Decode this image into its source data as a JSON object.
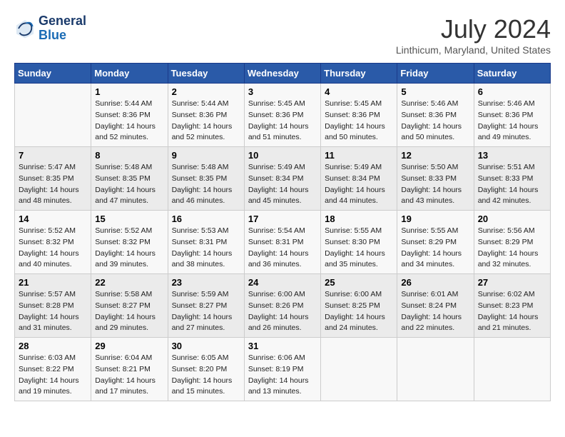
{
  "header": {
    "logo_line1": "General",
    "logo_line2": "Blue",
    "month_year": "July 2024",
    "location": "Linthicum, Maryland, United States"
  },
  "weekdays": [
    "Sunday",
    "Monday",
    "Tuesday",
    "Wednesday",
    "Thursday",
    "Friday",
    "Saturday"
  ],
  "weeks": [
    [
      {
        "day": "",
        "info": ""
      },
      {
        "day": "1",
        "info": "Sunrise: 5:44 AM\nSunset: 8:36 PM\nDaylight: 14 hours\nand 52 minutes."
      },
      {
        "day": "2",
        "info": "Sunrise: 5:44 AM\nSunset: 8:36 PM\nDaylight: 14 hours\nand 52 minutes."
      },
      {
        "day": "3",
        "info": "Sunrise: 5:45 AM\nSunset: 8:36 PM\nDaylight: 14 hours\nand 51 minutes."
      },
      {
        "day": "4",
        "info": "Sunrise: 5:45 AM\nSunset: 8:36 PM\nDaylight: 14 hours\nand 50 minutes."
      },
      {
        "day": "5",
        "info": "Sunrise: 5:46 AM\nSunset: 8:36 PM\nDaylight: 14 hours\nand 50 minutes."
      },
      {
        "day": "6",
        "info": "Sunrise: 5:46 AM\nSunset: 8:36 PM\nDaylight: 14 hours\nand 49 minutes."
      }
    ],
    [
      {
        "day": "7",
        "info": "Sunrise: 5:47 AM\nSunset: 8:35 PM\nDaylight: 14 hours\nand 48 minutes."
      },
      {
        "day": "8",
        "info": "Sunrise: 5:48 AM\nSunset: 8:35 PM\nDaylight: 14 hours\nand 47 minutes."
      },
      {
        "day": "9",
        "info": "Sunrise: 5:48 AM\nSunset: 8:35 PM\nDaylight: 14 hours\nand 46 minutes."
      },
      {
        "day": "10",
        "info": "Sunrise: 5:49 AM\nSunset: 8:34 PM\nDaylight: 14 hours\nand 45 minutes."
      },
      {
        "day": "11",
        "info": "Sunrise: 5:49 AM\nSunset: 8:34 PM\nDaylight: 14 hours\nand 44 minutes."
      },
      {
        "day": "12",
        "info": "Sunrise: 5:50 AM\nSunset: 8:33 PM\nDaylight: 14 hours\nand 43 minutes."
      },
      {
        "day": "13",
        "info": "Sunrise: 5:51 AM\nSunset: 8:33 PM\nDaylight: 14 hours\nand 42 minutes."
      }
    ],
    [
      {
        "day": "14",
        "info": "Sunrise: 5:52 AM\nSunset: 8:32 PM\nDaylight: 14 hours\nand 40 minutes."
      },
      {
        "day": "15",
        "info": "Sunrise: 5:52 AM\nSunset: 8:32 PM\nDaylight: 14 hours\nand 39 minutes."
      },
      {
        "day": "16",
        "info": "Sunrise: 5:53 AM\nSunset: 8:31 PM\nDaylight: 14 hours\nand 38 minutes."
      },
      {
        "day": "17",
        "info": "Sunrise: 5:54 AM\nSunset: 8:31 PM\nDaylight: 14 hours\nand 36 minutes."
      },
      {
        "day": "18",
        "info": "Sunrise: 5:55 AM\nSunset: 8:30 PM\nDaylight: 14 hours\nand 35 minutes."
      },
      {
        "day": "19",
        "info": "Sunrise: 5:55 AM\nSunset: 8:29 PM\nDaylight: 14 hours\nand 34 minutes."
      },
      {
        "day": "20",
        "info": "Sunrise: 5:56 AM\nSunset: 8:29 PM\nDaylight: 14 hours\nand 32 minutes."
      }
    ],
    [
      {
        "day": "21",
        "info": "Sunrise: 5:57 AM\nSunset: 8:28 PM\nDaylight: 14 hours\nand 31 minutes."
      },
      {
        "day": "22",
        "info": "Sunrise: 5:58 AM\nSunset: 8:27 PM\nDaylight: 14 hours\nand 29 minutes."
      },
      {
        "day": "23",
        "info": "Sunrise: 5:59 AM\nSunset: 8:27 PM\nDaylight: 14 hours\nand 27 minutes."
      },
      {
        "day": "24",
        "info": "Sunrise: 6:00 AM\nSunset: 8:26 PM\nDaylight: 14 hours\nand 26 minutes."
      },
      {
        "day": "25",
        "info": "Sunrise: 6:00 AM\nSunset: 8:25 PM\nDaylight: 14 hours\nand 24 minutes."
      },
      {
        "day": "26",
        "info": "Sunrise: 6:01 AM\nSunset: 8:24 PM\nDaylight: 14 hours\nand 22 minutes."
      },
      {
        "day": "27",
        "info": "Sunrise: 6:02 AM\nSunset: 8:23 PM\nDaylight: 14 hours\nand 21 minutes."
      }
    ],
    [
      {
        "day": "28",
        "info": "Sunrise: 6:03 AM\nSunset: 8:22 PM\nDaylight: 14 hours\nand 19 minutes."
      },
      {
        "day": "29",
        "info": "Sunrise: 6:04 AM\nSunset: 8:21 PM\nDaylight: 14 hours\nand 17 minutes."
      },
      {
        "day": "30",
        "info": "Sunrise: 6:05 AM\nSunset: 8:20 PM\nDaylight: 14 hours\nand 15 minutes."
      },
      {
        "day": "31",
        "info": "Sunrise: 6:06 AM\nSunset: 8:19 PM\nDaylight: 14 hours\nand 13 minutes."
      },
      {
        "day": "",
        "info": ""
      },
      {
        "day": "",
        "info": ""
      },
      {
        "day": "",
        "info": ""
      }
    ]
  ]
}
